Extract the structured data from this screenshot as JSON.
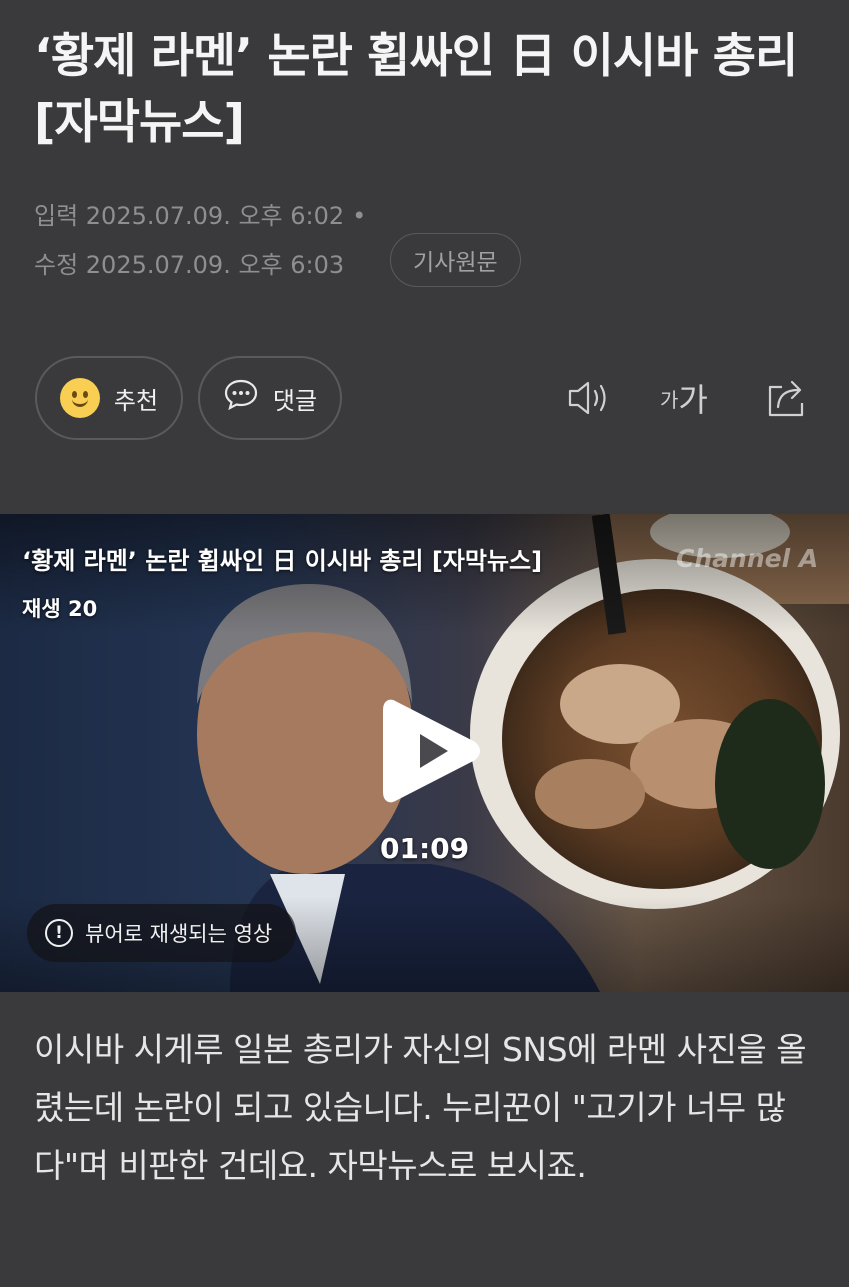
{
  "article": {
    "headline": "‘황제 라멘’ 논란 휩싸인 日 이시바 총리 [자막뉴스]",
    "input_time": "입력 2025.07.09. 오후 6:02",
    "input_dot": "•",
    "edit_time": "수정 2025.07.09. 오후 6:03",
    "original_link_label": "기사원문",
    "body": "이시바 시게루 일본 총리가 자신의 SNS에 라멘 사진을 올렸는데 논란이 되고 있습니다. 누리꾼이 \"고기가 너무 많다\"며 비판한 건데요. 자막뉴스로 보시죠."
  },
  "actions": {
    "recommend_label": "추천",
    "comment_label": "댓글",
    "fontsize_small": "가",
    "fontsize_large": "가"
  },
  "video": {
    "title": "‘황제 라멘’ 논란 휩싸인 日 이시바 총리 [자막뉴스]",
    "channel_logo": "Channel A",
    "views": "재생 20",
    "duration": "01:09",
    "notice": "뷰어로 재생되는 영상",
    "notice_icon": "!"
  },
  "icons": {
    "recommend": "smiley-icon",
    "comment": "speech-bubble-icon",
    "speaker": "speaker-icon",
    "fontsize": "font-size-icon",
    "share": "share-icon",
    "play": "play-icon",
    "info": "info-icon"
  },
  "colors": {
    "background": "#3a3a3c",
    "smiley": "#f9cf53",
    "meta_text": "#8e8e93"
  }
}
